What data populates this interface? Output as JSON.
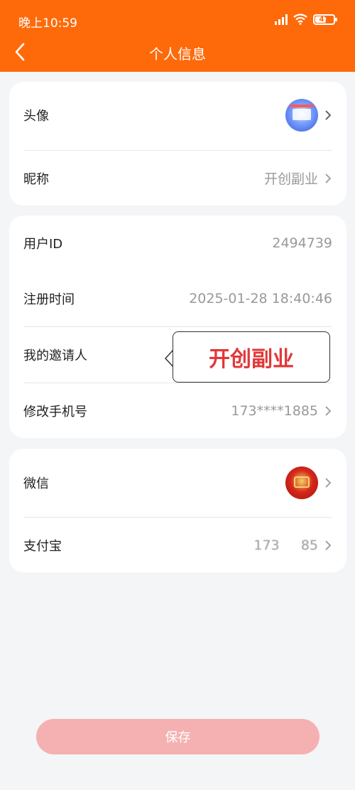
{
  "status_bar": {
    "time": "晚上10:59",
    "battery": "47",
    "network": "HD"
  },
  "header": {
    "title": "个人信息",
    "back_icon": "chevron-left-icon"
  },
  "profile_card": {
    "avatar_label": "头像",
    "nickname_label": "昵称",
    "nickname_value": "开创副业"
  },
  "account_card": {
    "user_id_label": "用户ID",
    "user_id_value": "2494739",
    "register_label": "注册时间",
    "register_value": "2025-01-28 18:40:46",
    "inviter_label": "我的邀请人",
    "inviter_tooltip": "开创副业",
    "phone_label": "修改手机号",
    "phone_value": "173****1885"
  },
  "binding_card": {
    "wechat_label": "微信",
    "alipay_label": "支付宝",
    "alipay_value": "173     85"
  },
  "save_button": "保存",
  "colors": {
    "header_bg": "#fe6a0a",
    "save_bg": "#f5b1b1",
    "tooltip_text": "#e2383a"
  }
}
